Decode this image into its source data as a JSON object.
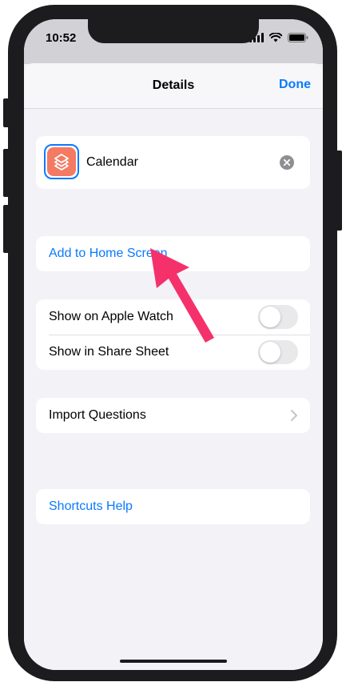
{
  "status": {
    "time": "10:52"
  },
  "nav": {
    "title": "Details",
    "done_label": "Done"
  },
  "shortcut": {
    "name": "Calendar",
    "icon": "layers-icon",
    "icon_color": "#f47a63"
  },
  "actions": {
    "add_home": "Add to Home Screen"
  },
  "toggles": [
    {
      "label": "Show on Apple Watch",
      "on": false
    },
    {
      "label": "Show in Share Sheet",
      "on": false
    }
  ],
  "import": {
    "label": "Import Questions"
  },
  "help": {
    "label": "Shortcuts Help"
  },
  "colors": {
    "accent": "#0a7aff",
    "annotation_arrow": "#f5316c"
  }
}
